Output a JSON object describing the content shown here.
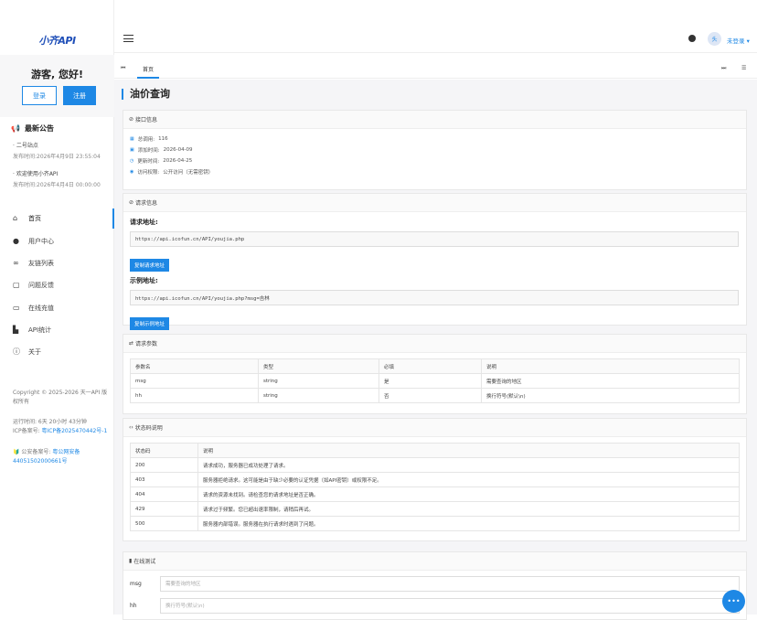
{
  "sidebar": {
    "logo_text": "小齐API",
    "greeting": "游客, 您好!",
    "login_label": "登录",
    "register_label": "注册",
    "notice_title": "最新公告",
    "notices": [
      {
        "title": "· 二号站点",
        "date": "发布时间:2026年4月9日 23:55:04"
      },
      {
        "title": "· 欢迎使用小齐API",
        "date": "发布时间:2026年4月4日 00:00:00"
      }
    ],
    "nav": [
      {
        "label": "首页",
        "icon": "home-icon"
      },
      {
        "label": "用户中心",
        "icon": "user-icon"
      },
      {
        "label": "友链列表",
        "icon": "link-icon"
      },
      {
        "label": "问题反馈",
        "icon": "feedback-icon"
      },
      {
        "label": "在线充值",
        "icon": "card-icon"
      },
      {
        "label": "API统计",
        "icon": "chart-icon"
      },
      {
        "label": "关于",
        "icon": "info-icon"
      }
    ],
    "copyright": "Copyright © 2025-2026 天一API 版权所有",
    "runtime": "运行时间: 6天 20小时 43分钟",
    "icp_label": "ICP备案号:",
    "icp_value": "粤ICP备2025470442号-1",
    "police_label": "公安备案号:",
    "police_value": "粤公网安备44051502000661号"
  },
  "topbar": {
    "login_text": "未登录",
    "avatar_text": "头"
  },
  "tabs": {
    "prev": "⏮",
    "home": "首页",
    "next": "⏭",
    "menu": "☰"
  },
  "main": {
    "title": "油价查询",
    "info_header": "接口信息",
    "info": [
      {
        "label": "总调用:",
        "value": "116"
      },
      {
        "label": "添加时间:",
        "value": "2026-04-09"
      },
      {
        "label": "更新时间:",
        "value": "2026-04-25"
      },
      {
        "label": "访问权限:",
        "value": "公开访问（无需密钥）"
      }
    ],
    "req_header": "请求信息",
    "req_url_label": "请求地址:",
    "req_url": "https://api.icofun.cn/API/youjia.php",
    "copy_req_label": "复制请求地址",
    "example_label": "示例地址:",
    "example_url": "https://api.icofun.cn/API/youjia.php?msg=吉林",
    "copy_example_label": "复制示例地址",
    "params_header": "请求参数",
    "params_cols": [
      "参数名",
      "类型",
      "必填",
      "说明"
    ],
    "params_rows": [
      [
        "msg",
        "string",
        "是",
        "需要查询的地区"
      ],
      [
        "hh",
        "string",
        "否",
        "换行符号(默认\\n)"
      ]
    ],
    "status_header": "状态码说明",
    "status_cols": [
      "状态码",
      "说明"
    ],
    "status_rows": [
      [
        "200",
        "请求成功，服务器已成功处理了请求。"
      ],
      [
        "403",
        "服务器拒绝请求。这可能是由于缺少必要的认证凭据（如API密钥）或权限不足。"
      ],
      [
        "404",
        "请求的资源未找到。请检查您的请求地址是否正确。"
      ],
      [
        "429",
        "请求过于频繁。您已超出速率限制，请稍后再试。"
      ],
      [
        "500",
        "服务器内部错误。服务器在执行请求时遇到了问题。"
      ]
    ],
    "test_header": "在线测试",
    "test_fields": [
      {
        "name": "msg",
        "placeholder": "需要查询的地区"
      },
      {
        "name": "hh",
        "placeholder": "换行符号(默认\\n)"
      }
    ]
  },
  "colors": {
    "accent": "#1e88e5",
    "bg": "#f5f5f7"
  }
}
